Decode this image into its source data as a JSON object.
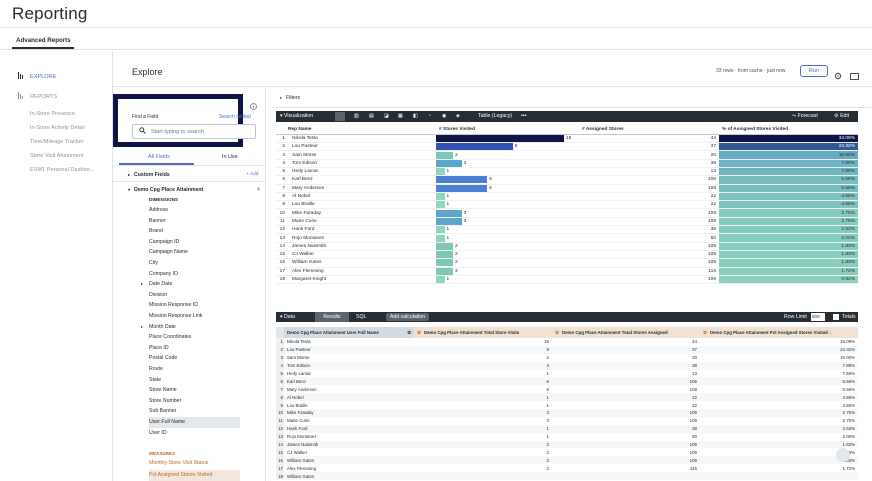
{
  "app": {
    "title": "Reporting",
    "tab": "Advanced Reports"
  },
  "sidebar": {
    "explore": "EXPLORE",
    "reports": "REPORTS",
    "links": [
      "In-Store Presence",
      "In-Store Activity Detail",
      "Time/Mileage Tracker",
      "Store Visit Attainment",
      "ESM1 Personal Dashbo..."
    ]
  },
  "explore": {
    "heading": "Explore",
    "status": "33 rows · from cache · just now",
    "run_label": "Run"
  },
  "fields": {
    "find_label": "Find a Field",
    "search_global": "Search Global",
    "search_placeholder": "Start typing to search",
    "tab_all": "All Fields",
    "tab_in_use": "In Use",
    "custom_fields": "Custom Fields",
    "add": "+ Add",
    "view_name": "Demo Cpg Place Attainment",
    "view_count": "4",
    "dimensions_label": "DIMENSIONS",
    "dimensions": [
      "Address",
      "Banner",
      "Brand",
      "Campaign ID",
      "Campaign Name",
      "City",
      "Company ID",
      "Date Date",
      "Division",
      "Mission Response ID",
      "Mission Response Link",
      "Month Date",
      "Place Coordinates",
      "Place ID",
      "Postal Code",
      "Route",
      "State",
      "Store Name",
      "Store Number",
      "Sub Banner",
      "User Full Name",
      "User ID"
    ],
    "expandable": [
      "Date Date",
      "Month Date"
    ],
    "selected_dimension": "User Full Name",
    "measures_label": "MEASURES",
    "measures": [
      "Monthly Store Visit Status",
      "Pct Assigned Stores Visited"
    ]
  },
  "filters": {
    "label": "Filters"
  },
  "visualization": {
    "label": "Visualization",
    "type_label": "Table (Legacy)",
    "more": "•••",
    "forecast": "Forecast",
    "edit": "Edit",
    "columns": [
      "Rep Name",
      "# Stores Visited",
      "# Assigned Stores",
      "% of Assigned Stores Visited"
    ],
    "rows": [
      {
        "n": "1",
        "name": "Nikola Tesla",
        "visited": 15,
        "assigned": 44,
        "pct": "34.09%",
        "pct_value": 34.09
      },
      {
        "n": "2",
        "name": "Lou Pasteur",
        "visited": 9,
        "assigned": 37,
        "pct": "24.32%",
        "pct_value": 24.32
      },
      {
        "n": "3",
        "name": "Sam Morse",
        "visited": 2,
        "assigned": 20,
        "pct": "10.00%",
        "pct_value": 10.0
      },
      {
        "n": "4",
        "name": "Tom Edison",
        "visited": 3,
        "assigned": 38,
        "pct": "7.89%",
        "pct_value": 7.89
      },
      {
        "n": "5",
        "name": "Hedy Lamar",
        "visited": 1,
        "assigned": 13,
        "pct": "7.69%",
        "pct_value": 7.69
      },
      {
        "n": "6",
        "name": "Karl Benz",
        "visited": 6,
        "assigned": 106,
        "pct": "5.66%",
        "pct_value": 5.66
      },
      {
        "n": "7",
        "name": "Mary Anderson",
        "visited": 6,
        "assigned": 108,
        "pct": "5.56%",
        "pct_value": 5.56
      },
      {
        "n": "8",
        "name": "Al Nobel",
        "visited": 1,
        "assigned": 22,
        "pct": "4.55%",
        "pct_value": 4.55
      },
      {
        "n": "9",
        "name": "Lou Braille",
        "visited": 1,
        "assigned": 22,
        "pct": "4.55%",
        "pct_value": 4.55
      },
      {
        "n": "10",
        "name": "Mike Faraday",
        "visited": 3,
        "assigned": 109,
        "pct": "2.75%",
        "pct_value": 2.75
      },
      {
        "n": "11",
        "name": "Marie Curie",
        "visited": 3,
        "assigned": 109,
        "pct": "2.75%",
        "pct_value": 2.75
      },
      {
        "n": "12",
        "name": "Hank Ford",
        "visited": 1,
        "assigned": 38,
        "pct": "2.63%",
        "pct_value": 2.63
      },
      {
        "n": "13",
        "name": "Rojo Montanez",
        "visited": 1,
        "assigned": 50,
        "pct": "2.00%",
        "pct_value": 2.0
      },
      {
        "n": "14",
        "name": "James Naismith",
        "visited": 2,
        "assigned": 109,
        "pct": "1.83%",
        "pct_value": 1.83
      },
      {
        "n": "15",
        "name": "CJ Walker",
        "visited": 2,
        "assigned": 109,
        "pct": "1.83%",
        "pct_value": 1.83
      },
      {
        "n": "16",
        "name": "William Gates",
        "visited": 2,
        "assigned": 109,
        "pct": "1.83%",
        "pct_value": 1.83
      },
      {
        "n": "17",
        "name": "Alex Flemming",
        "visited": 2,
        "assigned": 116,
        "pct": "1.72%",
        "pct_value": 1.72
      },
      {
        "n": "18",
        "name": "Margaret Knight",
        "visited": 1,
        "assigned": 109,
        "pct": "0.92%",
        "pct_value": 0.92
      }
    ],
    "bar_max": 15
  },
  "data": {
    "label": "Data",
    "tab_results": "Results",
    "tab_sql": "SQL",
    "add_calc": "Add calculation",
    "row_limit_label": "Row Limit",
    "row_limit": "500",
    "totals": "Totals",
    "columns": [
      "Demo Cpg Place Attainment User Full Name",
      "Demo Cpg Place Attainment Total Store Visits",
      "Demo Cpg Place Attainment Total Stores Assigned",
      "Demo Cpg Place Attainment Pct Assigned Stores Visited ↓"
    ],
    "rows": [
      [
        "1",
        "Nikola Tesla",
        "15",
        "44",
        "34.09%"
      ],
      [
        "2",
        "Lou Pasteur",
        "9",
        "37",
        "24.32%"
      ],
      [
        "3",
        "Sam Morse",
        "2",
        "20",
        "10.00%"
      ],
      [
        "4",
        "Tom Edison",
        "3",
        "38",
        "7.89%"
      ],
      [
        "5",
        "Hedy Lamar",
        "1",
        "13",
        "7.69%"
      ],
      [
        "6",
        "Karl Benz",
        "6",
        "106",
        "5.66%"
      ],
      [
        "7",
        "Mary Anderson",
        "6",
        "108",
        "5.56%"
      ],
      [
        "8",
        "Al Nobel",
        "1",
        "22",
        "4.55%"
      ],
      [
        "9",
        "Lou Braille",
        "1",
        "22",
        "4.55%"
      ],
      [
        "10",
        "Mike Faraday",
        "3",
        "109",
        "2.75%"
      ],
      [
        "11",
        "Marie Curie",
        "3",
        "109",
        "2.75%"
      ],
      [
        "12",
        "Hank Ford",
        "1",
        "38",
        "2.63%"
      ],
      [
        "13",
        "Rojo Montanez",
        "1",
        "50",
        "2.00%"
      ],
      [
        "14",
        "James Naismith",
        "2",
        "109",
        "1.83%"
      ],
      [
        "15",
        "CJ Walker",
        "2",
        "109",
        "1.83%"
      ],
      [
        "16",
        "William Gates",
        "2",
        "109",
        "1.83%"
      ],
      [
        "17",
        "Alex Flemming",
        "2",
        "116",
        "1.72%"
      ],
      [
        "18",
        "William Gates",
        "",
        "",
        ""
      ]
    ]
  },
  "colors": {
    "dark_navy": "#0f1547",
    "accent_blue": "#4a6ec9",
    "header_dark": "#262d33",
    "teal": "#7fd1b9"
  }
}
